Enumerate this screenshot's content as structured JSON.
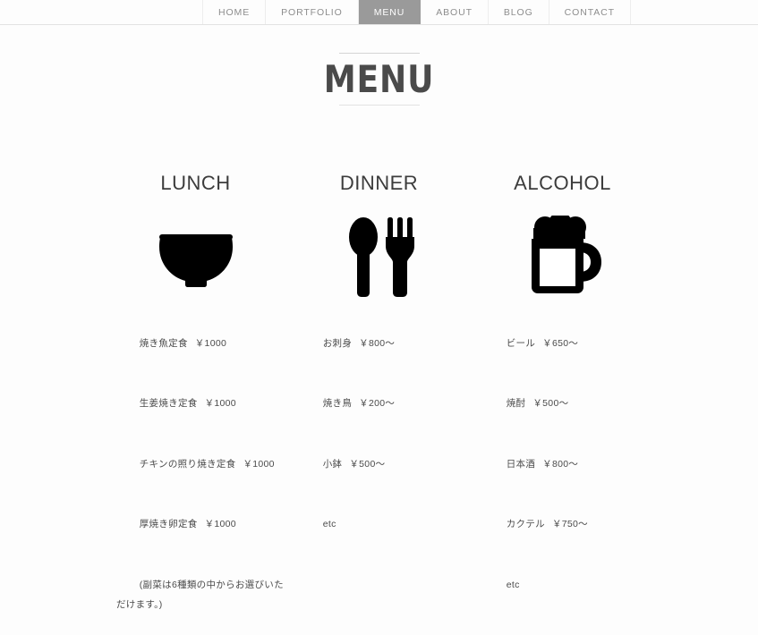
{
  "nav": {
    "items": [
      {
        "label": "HOME",
        "active": false
      },
      {
        "label": "PORTFOLIO",
        "active": false
      },
      {
        "label": "MENU",
        "active": true
      },
      {
        "label": "ABOUT",
        "active": false
      },
      {
        "label": "BLOG",
        "active": false
      },
      {
        "label": "CONTACT",
        "active": false
      }
    ]
  },
  "page": {
    "title": "MENU"
  },
  "colors": {
    "active_tab_bg": "#9a9a9a",
    "nav_text": "#8d8d8d",
    "heading": "#3c3c3c",
    "body_text": "#4b4b4b",
    "icon": "#000000",
    "background": "#fdfdfd",
    "rule": "#d5d5d5"
  },
  "sections": [
    {
      "heading": "LUNCH",
      "icon": "rice-bowl-icon",
      "items": [
        {
          "name": "焼き魚定食",
          "price": "￥1000"
        },
        {
          "name": "生姜焼き定食",
          "price": "￥1000"
        },
        {
          "name": "チキンの照り焼き定食",
          "price": "￥1000"
        },
        {
          "name": "厚焼き卵定食",
          "price": "￥1000"
        },
        {
          "name": "(副菜は6種類の中からお選びいただけます。)",
          "price": ""
        }
      ]
    },
    {
      "heading": "DINNER",
      "icon": "spoon-and-fork-icon",
      "items": [
        {
          "name": "お刺身",
          "price": "￥800〜"
        },
        {
          "name": "焼き鳥",
          "price": "￥200〜"
        },
        {
          "name": "小鉢",
          "price": "￥500〜"
        },
        {
          "name": "etc",
          "price": ""
        }
      ]
    },
    {
      "heading": "ALCOHOL",
      "icon": "beer-mug-icon",
      "items": [
        {
          "name": "ビール",
          "price": "￥650〜"
        },
        {
          "name": "焼酎",
          "price": "￥500〜"
        },
        {
          "name": "日本酒",
          "price": "￥800〜"
        },
        {
          "name": "カクテル",
          "price": "￥750〜"
        },
        {
          "name": "etc",
          "price": ""
        }
      ]
    }
  ]
}
